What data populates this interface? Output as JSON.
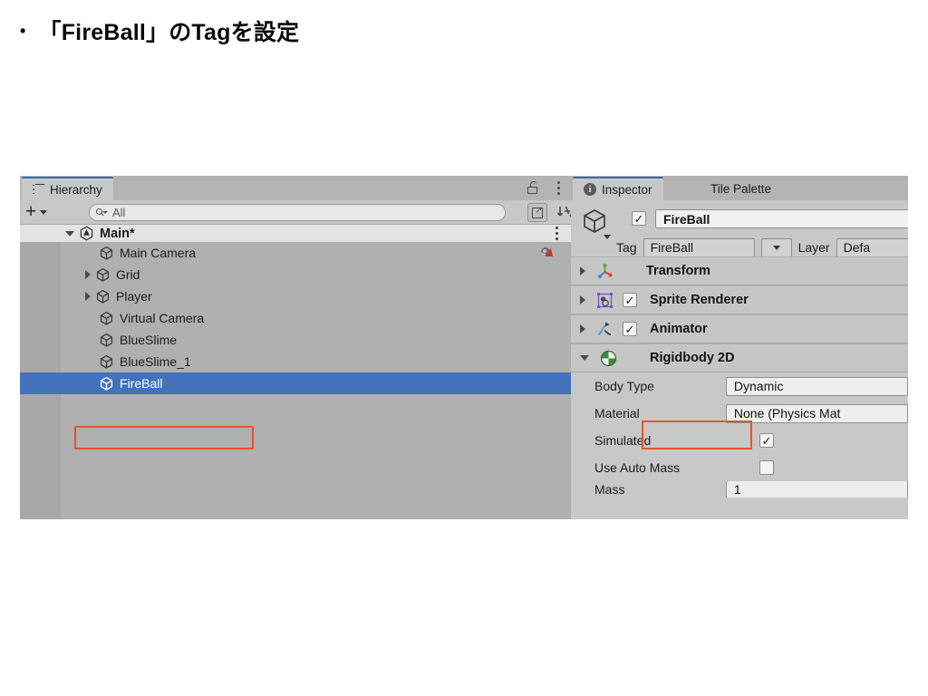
{
  "slide": {
    "bullet": "•",
    "title": "「FireBall」のTagを設定"
  },
  "colors": {
    "annotation": "#e8512b",
    "selection": "#4272ba",
    "tab_active": "#c8c8c8",
    "panel_bg": "#c2c2c2",
    "tree_bg": "#b0b0b0"
  },
  "hierarchy": {
    "tab_label": "Hierarchy",
    "tab_icon": "list-icon",
    "lock_icon": "lock-icon",
    "menu_icon": "kebab-menu-icon",
    "toolbar": {
      "add_label": "+",
      "add_caret": "▾",
      "search_placeholder": "All",
      "search_value": "All",
      "search_icon": "search-dropdown-icon",
      "scene_search_icon": "search-in-scene-icon",
      "sort_icon": "alphabetical-sort-icon"
    },
    "items": [
      {
        "label": "Main*",
        "depth": 0,
        "arrow": "open",
        "icon": "unity-scene-icon",
        "selected": false,
        "badge": null
      },
      {
        "label": "Main Camera",
        "depth": 1,
        "arrow": "none",
        "icon": "gameobject-cube-icon",
        "selected": false,
        "badge": "prefab-icon"
      },
      {
        "label": "Grid",
        "depth": 1,
        "arrow": "closed",
        "icon": "gameobject-cube-icon",
        "selected": false,
        "badge": null
      },
      {
        "label": "Player",
        "depth": 1,
        "arrow": "closed",
        "icon": "gameobject-cube-icon",
        "selected": false,
        "badge": null
      },
      {
        "label": "Virtual Camera",
        "depth": 1,
        "arrow": "none",
        "icon": "gameobject-cube-icon",
        "selected": false,
        "badge": null
      },
      {
        "label": "BlueSlime",
        "depth": 1,
        "arrow": "none",
        "icon": "gameobject-cube-icon",
        "selected": false,
        "badge": null
      },
      {
        "label": "BlueSlime_1",
        "depth": 1,
        "arrow": "none",
        "icon": "gameobject-cube-icon",
        "selected": false,
        "badge": null
      },
      {
        "label": "FireBall",
        "depth": 1,
        "arrow": "none",
        "icon": "gameobject-cube-icon",
        "selected": true,
        "badge": null
      }
    ]
  },
  "inspector": {
    "tabs": [
      {
        "label": "Inspector",
        "active": true,
        "icon": "info-icon"
      },
      {
        "label": "Tile Palette",
        "active": false,
        "icon": null
      }
    ],
    "gameobject": {
      "icon": "gameobject-cube-icon",
      "enabled": true,
      "enabled_mark": "✓",
      "name": "FireBall",
      "tag_label": "Tag",
      "tag_value": "FireBall",
      "tag_caret": "▼",
      "layer_label": "Layer",
      "layer_value": "Defa"
    },
    "components": [
      {
        "name": "Transform",
        "icon": "transform-axis-icon",
        "expanded": false,
        "has_checkbox": false,
        "checked": false
      },
      {
        "name": "Sprite Renderer",
        "icon": "sprite-renderer-icon",
        "expanded": false,
        "has_checkbox": true,
        "checked": true
      },
      {
        "name": "Animator",
        "icon": "animator-icon",
        "expanded": false,
        "has_checkbox": true,
        "checked": true
      },
      {
        "name": "Rigidbody 2D",
        "icon": "rigidbody2d-icon",
        "expanded": true,
        "has_checkbox": false,
        "checked": false
      }
    ],
    "rigidbody2d_props": [
      {
        "label": "Body Type",
        "type": "dropdown",
        "value": "Dynamic"
      },
      {
        "label": "Material",
        "type": "object",
        "value": "None (Physics Mat"
      },
      {
        "label": "Simulated",
        "type": "checkbox",
        "value": true,
        "mark": "✓"
      },
      {
        "label": "Use Auto Mass",
        "type": "checkbox",
        "value": false,
        "mark": ""
      },
      {
        "label": "Mass",
        "type": "number",
        "value": "1"
      }
    ]
  }
}
